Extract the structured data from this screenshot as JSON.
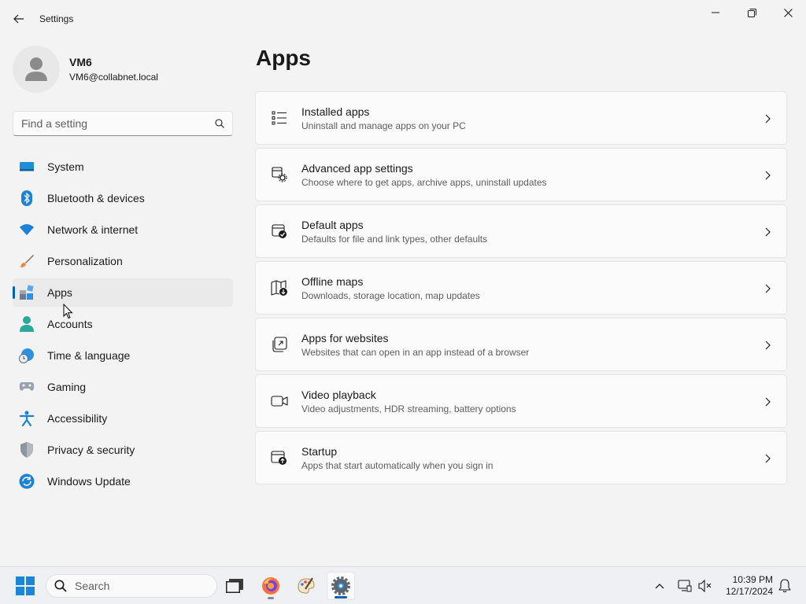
{
  "window": {
    "title": "Settings"
  },
  "profile": {
    "name": "VM6",
    "email": "VM6@collabnet.local"
  },
  "search": {
    "placeholder": "Find a setting"
  },
  "nav": {
    "items": [
      {
        "label": "System",
        "icon": "system-icon"
      },
      {
        "label": "Bluetooth & devices",
        "icon": "bluetooth-icon"
      },
      {
        "label": "Network & internet",
        "icon": "wifi-icon"
      },
      {
        "label": "Personalization",
        "icon": "brush-icon"
      },
      {
        "label": "Apps",
        "icon": "apps-icon",
        "active": true
      },
      {
        "label": "Accounts",
        "icon": "person-icon"
      },
      {
        "label": "Time & language",
        "icon": "clock-globe-icon"
      },
      {
        "label": "Gaming",
        "icon": "gamepad-icon"
      },
      {
        "label": "Accessibility",
        "icon": "accessibility-icon"
      },
      {
        "label": "Privacy & security",
        "icon": "shield-icon"
      },
      {
        "label": "Windows Update",
        "icon": "update-icon"
      }
    ]
  },
  "main": {
    "title": "Apps",
    "cards": [
      {
        "title": "Installed apps",
        "desc": "Uninstall and manage apps on your PC",
        "icon": "list-icon"
      },
      {
        "title": "Advanced app settings",
        "desc": "Choose where to get apps, archive apps, uninstall updates",
        "icon": "app-gear-icon"
      },
      {
        "title": "Default apps",
        "desc": "Defaults for file and link types, other defaults",
        "icon": "default-apps-icon"
      },
      {
        "title": "Offline maps",
        "desc": "Downloads, storage location, map updates",
        "icon": "map-download-icon"
      },
      {
        "title": "Apps for websites",
        "desc": "Websites that can open in an app instead of a browser",
        "icon": "open-in-app-icon"
      },
      {
        "title": "Video playback",
        "desc": "Video adjustments, HDR streaming, battery options",
        "icon": "video-camera-icon"
      },
      {
        "title": "Startup",
        "desc": "Apps that start automatically when you sign in",
        "icon": "startup-icon"
      }
    ]
  },
  "taskbar": {
    "search_label": "Search",
    "apps": [
      "file-explorer-icon",
      "firefox-icon",
      "paint-icon",
      "settings-gear-icon"
    ],
    "time": "10:39 PM",
    "date": "12/17/2024"
  },
  "colors": {
    "accent": "#005fb8",
    "background": "#f3f3f3",
    "card": "#fbfbfb"
  }
}
